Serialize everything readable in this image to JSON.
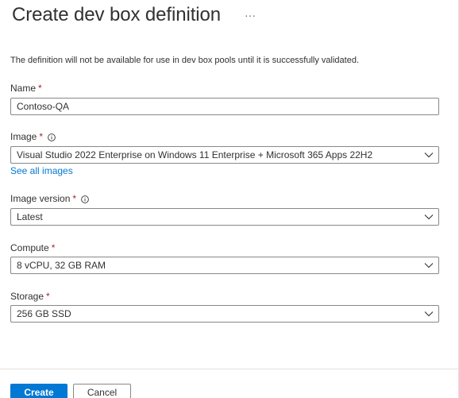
{
  "header": {
    "title": "Create dev box definition",
    "more_label": "···"
  },
  "info_message": "The definition will not be available for use in dev box pools until it is successfully validated.",
  "required_marker": "*",
  "fields": {
    "name": {
      "label": "Name",
      "value": "Contoso-QA"
    },
    "image": {
      "label": "Image",
      "value": "Visual Studio 2022 Enterprise on Windows 11 Enterprise + Microsoft 365 Apps 22H2",
      "link_label": "See all images"
    },
    "image_version": {
      "label": "Image version",
      "value": "Latest"
    },
    "compute": {
      "label": "Compute",
      "value": "8 vCPU, 32 GB RAM"
    },
    "storage": {
      "label": "Storage",
      "value": "256 GB SSD"
    }
  },
  "footer": {
    "create_label": "Create",
    "cancel_label": "Cancel"
  },
  "icons": {
    "info": "info-icon",
    "dropdown": "chevron-down-icon",
    "more": "more-icon"
  },
  "colors": {
    "accent": "#0078d4",
    "required": "#a4262c",
    "border": "#8a8886",
    "text": "#323130"
  }
}
